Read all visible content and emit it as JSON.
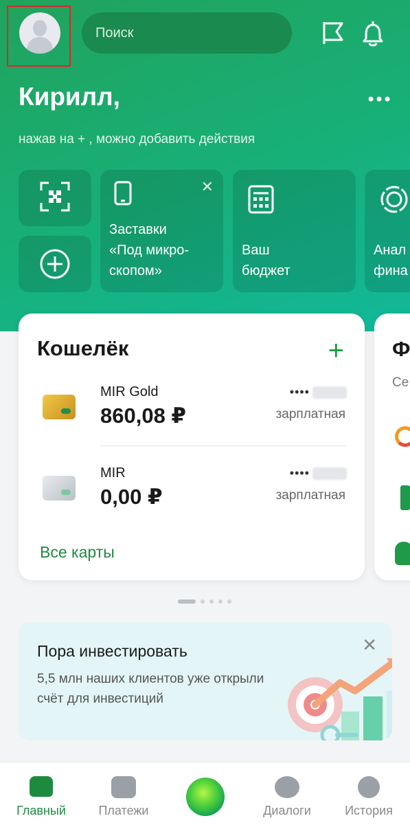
{
  "header": {
    "search_placeholder": "Поиск",
    "icons": [
      "avatar",
      "flag-icon",
      "bell-icon"
    ]
  },
  "greeting": {
    "name": "Кирилл,",
    "hint": "нажав на + , можно добавить действия"
  },
  "quick_tiles": [
    {
      "icon": "qr-scan-icon"
    },
    {
      "icon": "plus-circle-icon"
    },
    {
      "icon": "phone-icon",
      "label": "Заставки\n«Под микро-\nскопом»",
      "closable": true
    },
    {
      "icon": "calculator-icon",
      "label": "Ваш\nбюджет"
    },
    {
      "icon": "donut-chart-icon",
      "label": "Анал\nфина"
    }
  ],
  "wallet": {
    "title": "Кошелёк",
    "add_label": "+",
    "accounts": [
      {
        "name": "MIR Gold",
        "amount": "860,08 ₽",
        "mask": "••••",
        "type": "зарплатная",
        "card_color": "#e6b23a"
      },
      {
        "name": "MIR",
        "amount": "0,00 ₽",
        "mask": "••••",
        "type": "зарплатная",
        "card_color": "#d5d9dd"
      }
    ],
    "all_cards_label": "Все карты"
  },
  "peek_card": {
    "title": "Ф",
    "subtitle": "Се"
  },
  "promo": {
    "title": "Пора инвестировать",
    "text": "5,5 млн наших клиентов уже открыли счёт для инвестиций",
    "close_label": "✕"
  },
  "tabs": [
    {
      "label": "Главный",
      "active": true
    },
    {
      "label": "Платежи",
      "active": false
    },
    {
      "label": "",
      "active": false
    },
    {
      "label": "Диалоги",
      "active": false
    },
    {
      "label": "История",
      "active": false
    }
  ],
  "colors": {
    "brand_green": "#1e8a3e",
    "hero_start": "#21a35c",
    "hero_end": "#12b89a"
  }
}
